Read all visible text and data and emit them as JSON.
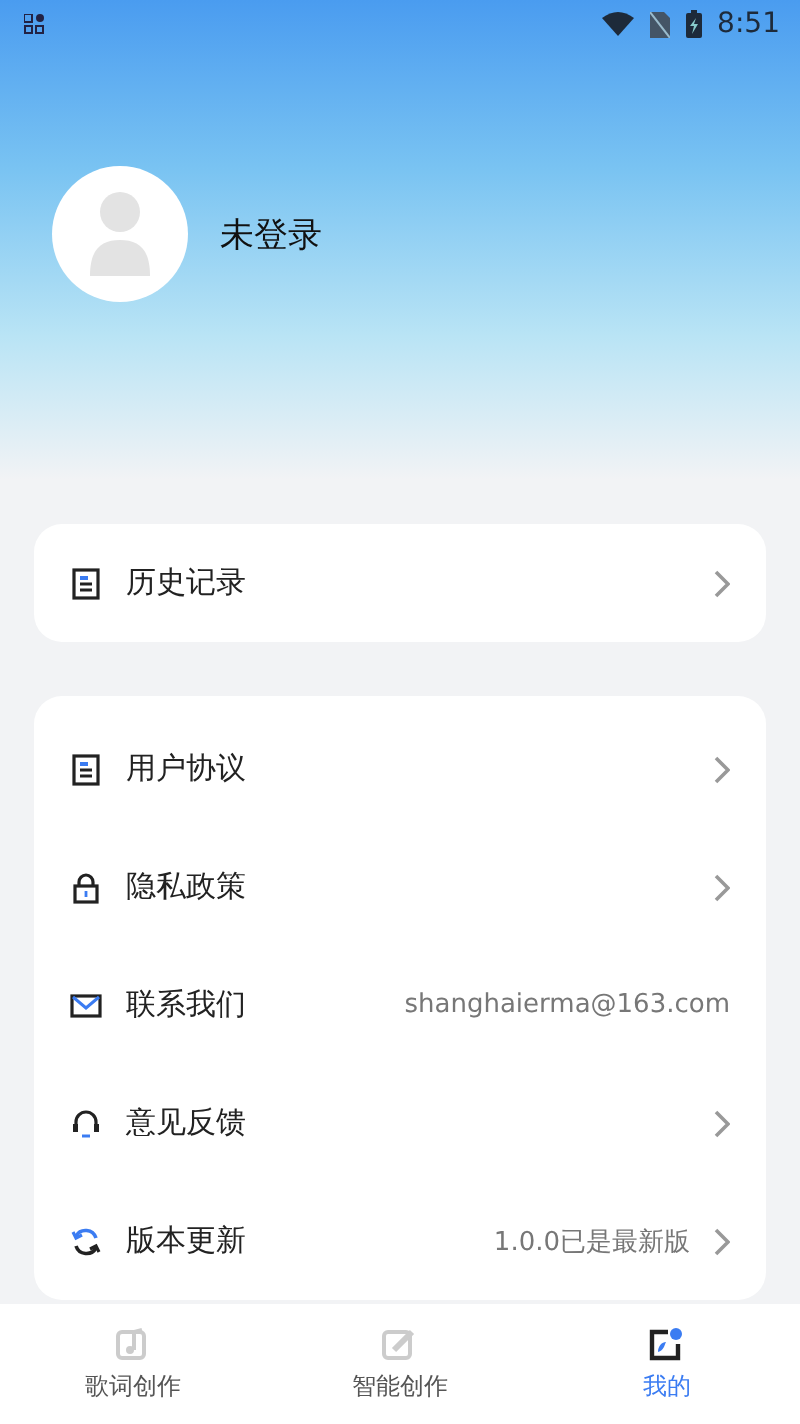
{
  "status_bar": {
    "time": "8:51"
  },
  "profile": {
    "name": "未登录"
  },
  "history_card": [
    {
      "label": "历史记录",
      "arrow": true
    }
  ],
  "settings_card": [
    {
      "label": "用户协议",
      "arrow": true
    },
    {
      "label": "隐私政策",
      "arrow": true
    },
    {
      "label": "联系我们",
      "value": "shanghaierma@163.com",
      "arrow": false
    },
    {
      "label": "意见反馈",
      "arrow": true
    },
    {
      "label": "版本更新",
      "value": "1.0.0已是最新版",
      "arrow": true
    }
  ],
  "tabs": [
    {
      "label": "歌词创作",
      "selected": false
    },
    {
      "label": "智能创作",
      "selected": false
    },
    {
      "label": "我的",
      "selected": true
    }
  ]
}
